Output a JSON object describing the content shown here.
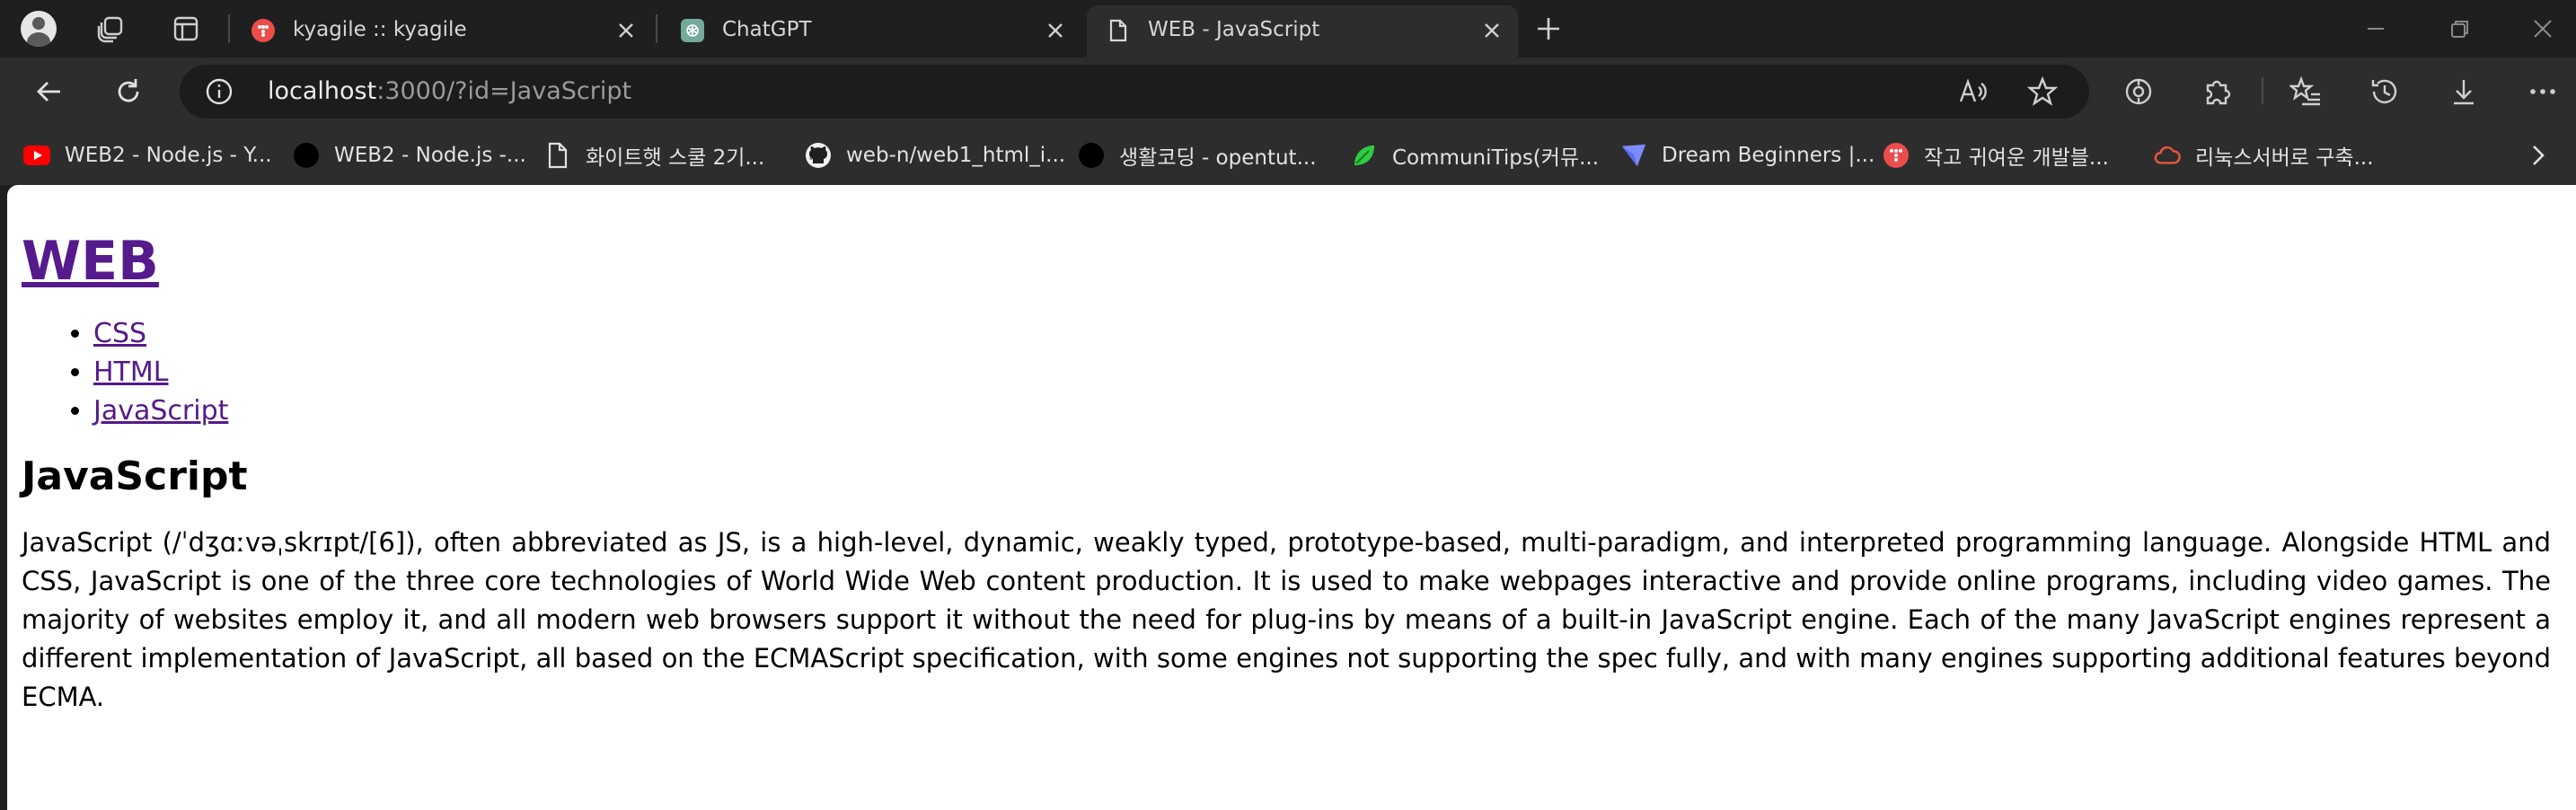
{
  "tabs": [
    {
      "title": "kyagile :: kyagile",
      "favicon": "tistory-icon",
      "color": "#eb4d4b"
    },
    {
      "title": "ChatGPT",
      "favicon": "chatgpt-icon",
      "color": "#74aa9c"
    },
    {
      "title": "WEB - JavaScript",
      "favicon": "page-icon",
      "active": true
    }
  ],
  "address_bar": {
    "host": "localhost",
    "rest": ":3000/?id=JavaScript"
  },
  "bookmarks": [
    {
      "label": "WEB2 - Node.js - Y...",
      "icon": "youtube-icon"
    },
    {
      "label": "WEB2 - Node.js -...",
      "icon": "opentutorials-icon"
    },
    {
      "label": "화이트햇 스쿨 2기...",
      "icon": "document-icon"
    },
    {
      "label": "web-n/web1_html_i...",
      "icon": "github-icon"
    },
    {
      "label": "생활코딩 - opentut...",
      "icon": "opentutorials-icon"
    },
    {
      "label": "CommuniTips(커뮤...",
      "icon": "leaf-icon"
    },
    {
      "label": "Dream Beginners |...",
      "icon": "dream-icon"
    },
    {
      "label": "작고 귀여운 개발블...",
      "icon": "tistory-icon"
    },
    {
      "label": "리눅스서버로 구축...",
      "icon": "cloud-icon"
    }
  ],
  "page": {
    "site_title": "WEB",
    "nav_links": [
      "CSS",
      "HTML",
      "JavaScript"
    ],
    "heading": "JavaScript",
    "body": "JavaScript (/ˈdʒɑːvəˌskrɪpt/[6]), often abbreviated as JS, is a high-level, dynamic, weakly typed, prototype-based, multi-paradigm, and interpreted programming language. Alongside HTML and CSS, JavaScript is one of the three core technologies of World Wide Web content production. It is used to make webpages interactive and provide online programs, including video games. The majority of websites employ it, and all modern web browsers support it without the need for plug-ins by means of a built-in JavaScript engine. Each of the many JavaScript engines represent a different implementation of JavaScript, all based on the ECMAScript specification, with some engines not supporting the spec fully, and with many engines supporting additional features beyond ECMA."
  },
  "colors": {
    "chrome_bg": "#1f1f1f",
    "toolbar_bg": "#2d2d2d",
    "visited_link": "#551a8b"
  }
}
